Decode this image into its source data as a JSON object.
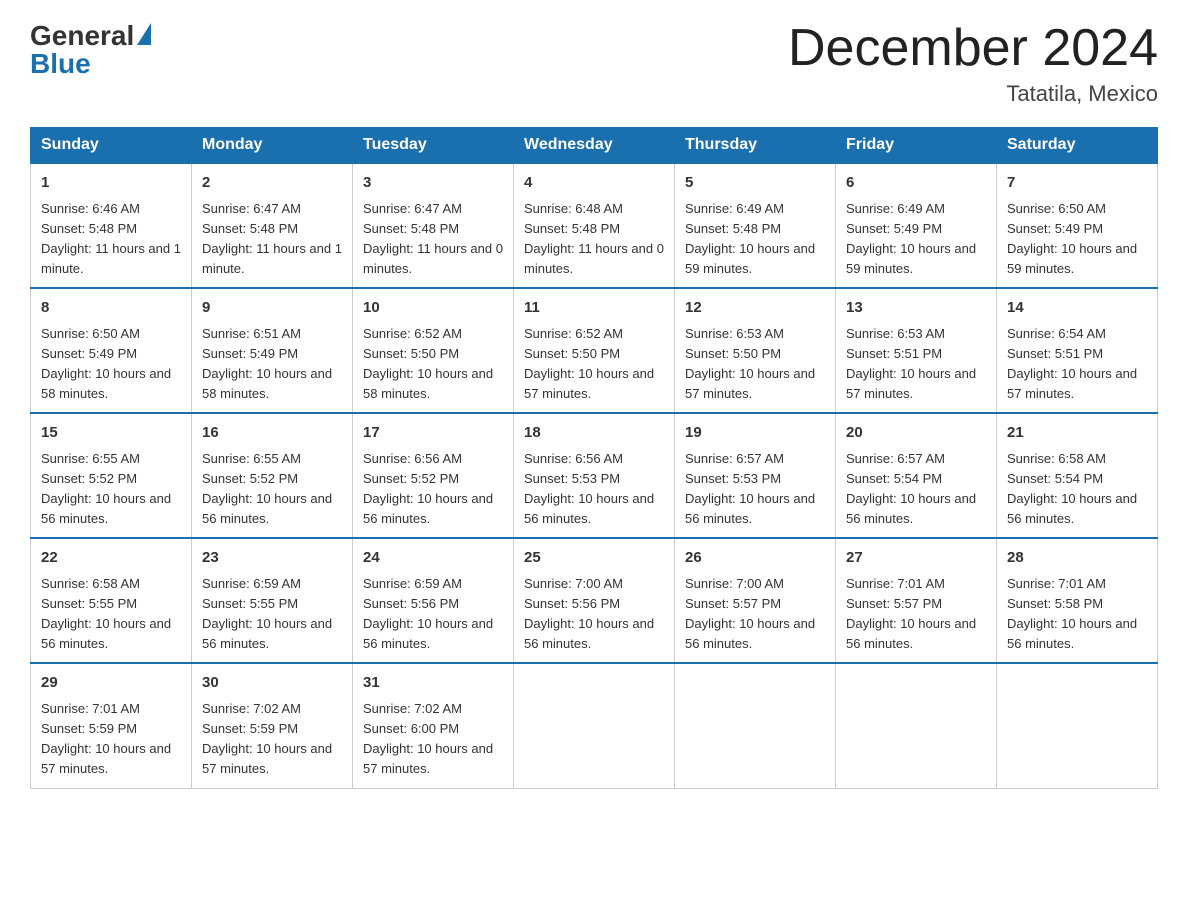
{
  "header": {
    "logo": {
      "general": "General",
      "blue": "Blue"
    },
    "title": "December 2024",
    "location": "Tatatila, Mexico"
  },
  "days_of_week": [
    "Sunday",
    "Monday",
    "Tuesday",
    "Wednesday",
    "Thursday",
    "Friday",
    "Saturday"
  ],
  "weeks": [
    [
      {
        "day": "1",
        "sunrise": "6:46 AM",
        "sunset": "5:48 PM",
        "daylight": "11 hours and 1 minute."
      },
      {
        "day": "2",
        "sunrise": "6:47 AM",
        "sunset": "5:48 PM",
        "daylight": "11 hours and 1 minute."
      },
      {
        "day": "3",
        "sunrise": "6:47 AM",
        "sunset": "5:48 PM",
        "daylight": "11 hours and 0 minutes."
      },
      {
        "day": "4",
        "sunrise": "6:48 AM",
        "sunset": "5:48 PM",
        "daylight": "11 hours and 0 minutes."
      },
      {
        "day": "5",
        "sunrise": "6:49 AM",
        "sunset": "5:48 PM",
        "daylight": "10 hours and 59 minutes."
      },
      {
        "day": "6",
        "sunrise": "6:49 AM",
        "sunset": "5:49 PM",
        "daylight": "10 hours and 59 minutes."
      },
      {
        "day": "7",
        "sunrise": "6:50 AM",
        "sunset": "5:49 PM",
        "daylight": "10 hours and 59 minutes."
      }
    ],
    [
      {
        "day": "8",
        "sunrise": "6:50 AM",
        "sunset": "5:49 PM",
        "daylight": "10 hours and 58 minutes."
      },
      {
        "day": "9",
        "sunrise": "6:51 AM",
        "sunset": "5:49 PM",
        "daylight": "10 hours and 58 minutes."
      },
      {
        "day": "10",
        "sunrise": "6:52 AM",
        "sunset": "5:50 PM",
        "daylight": "10 hours and 58 minutes."
      },
      {
        "day": "11",
        "sunrise": "6:52 AM",
        "sunset": "5:50 PM",
        "daylight": "10 hours and 57 minutes."
      },
      {
        "day": "12",
        "sunrise": "6:53 AM",
        "sunset": "5:50 PM",
        "daylight": "10 hours and 57 minutes."
      },
      {
        "day": "13",
        "sunrise": "6:53 AM",
        "sunset": "5:51 PM",
        "daylight": "10 hours and 57 minutes."
      },
      {
        "day": "14",
        "sunrise": "6:54 AM",
        "sunset": "5:51 PM",
        "daylight": "10 hours and 57 minutes."
      }
    ],
    [
      {
        "day": "15",
        "sunrise": "6:55 AM",
        "sunset": "5:52 PM",
        "daylight": "10 hours and 56 minutes."
      },
      {
        "day": "16",
        "sunrise": "6:55 AM",
        "sunset": "5:52 PM",
        "daylight": "10 hours and 56 minutes."
      },
      {
        "day": "17",
        "sunrise": "6:56 AM",
        "sunset": "5:52 PM",
        "daylight": "10 hours and 56 minutes."
      },
      {
        "day": "18",
        "sunrise": "6:56 AM",
        "sunset": "5:53 PM",
        "daylight": "10 hours and 56 minutes."
      },
      {
        "day": "19",
        "sunrise": "6:57 AM",
        "sunset": "5:53 PM",
        "daylight": "10 hours and 56 minutes."
      },
      {
        "day": "20",
        "sunrise": "6:57 AM",
        "sunset": "5:54 PM",
        "daylight": "10 hours and 56 minutes."
      },
      {
        "day": "21",
        "sunrise": "6:58 AM",
        "sunset": "5:54 PM",
        "daylight": "10 hours and 56 minutes."
      }
    ],
    [
      {
        "day": "22",
        "sunrise": "6:58 AM",
        "sunset": "5:55 PM",
        "daylight": "10 hours and 56 minutes."
      },
      {
        "day": "23",
        "sunrise": "6:59 AM",
        "sunset": "5:55 PM",
        "daylight": "10 hours and 56 minutes."
      },
      {
        "day": "24",
        "sunrise": "6:59 AM",
        "sunset": "5:56 PM",
        "daylight": "10 hours and 56 minutes."
      },
      {
        "day": "25",
        "sunrise": "7:00 AM",
        "sunset": "5:56 PM",
        "daylight": "10 hours and 56 minutes."
      },
      {
        "day": "26",
        "sunrise": "7:00 AM",
        "sunset": "5:57 PM",
        "daylight": "10 hours and 56 minutes."
      },
      {
        "day": "27",
        "sunrise": "7:01 AM",
        "sunset": "5:57 PM",
        "daylight": "10 hours and 56 minutes."
      },
      {
        "day": "28",
        "sunrise": "7:01 AM",
        "sunset": "5:58 PM",
        "daylight": "10 hours and 56 minutes."
      }
    ],
    [
      {
        "day": "29",
        "sunrise": "7:01 AM",
        "sunset": "5:59 PM",
        "daylight": "10 hours and 57 minutes."
      },
      {
        "day": "30",
        "sunrise": "7:02 AM",
        "sunset": "5:59 PM",
        "daylight": "10 hours and 57 minutes."
      },
      {
        "day": "31",
        "sunrise": "7:02 AM",
        "sunset": "6:00 PM",
        "daylight": "10 hours and 57 minutes."
      },
      null,
      null,
      null,
      null
    ]
  ],
  "labels": {
    "sunrise": "Sunrise:",
    "sunset": "Sunset:",
    "daylight": "Daylight:"
  }
}
